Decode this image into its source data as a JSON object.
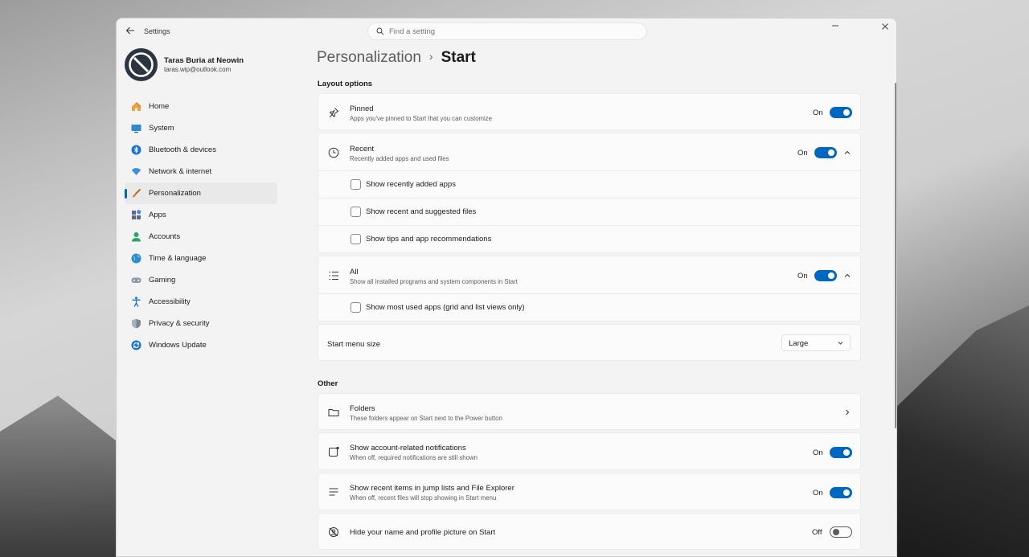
{
  "window": {
    "app_title": "Settings"
  },
  "search": {
    "placeholder": "Find a setting"
  },
  "user": {
    "name": "Taras Buria at Neowin",
    "email": "taras.wip@outlook.com"
  },
  "sidebar": {
    "items": [
      {
        "label": "Home",
        "icon": "home-icon"
      },
      {
        "label": "System",
        "icon": "monitor-icon"
      },
      {
        "label": "Bluetooth & devices",
        "icon": "bluetooth-icon"
      },
      {
        "label": "Network & internet",
        "icon": "wifi-icon"
      },
      {
        "label": "Personalization",
        "icon": "brush-icon",
        "active": true
      },
      {
        "label": "Apps",
        "icon": "apps-icon"
      },
      {
        "label": "Accounts",
        "icon": "person-icon"
      },
      {
        "label": "Time & language",
        "icon": "globe-icon"
      },
      {
        "label": "Gaming",
        "icon": "gamepad-icon"
      },
      {
        "label": "Accessibility",
        "icon": "accessibility-icon"
      },
      {
        "label": "Privacy & security",
        "icon": "shield-icon"
      },
      {
        "label": "Windows Update",
        "icon": "update-icon"
      }
    ]
  },
  "breadcrumb": {
    "parent": "Personalization",
    "separator": "›",
    "current": "Start"
  },
  "layout_options": {
    "heading": "Layout options",
    "pinned": {
      "title": "Pinned",
      "desc": "Apps you've pinned to Start that you can customize",
      "state": "On"
    },
    "recent": {
      "title": "Recent",
      "desc": "Recently added apps and used files",
      "state": "On",
      "options": [
        "Show recently added apps",
        "Show recent and suggested files",
        "Show tips and app recommendations"
      ]
    },
    "all": {
      "title": "All",
      "desc": "Show all installed programs and system components in Start",
      "state": "On",
      "options": [
        "Show most used apps (grid and list views only)"
      ]
    },
    "size": {
      "title": "Start menu size",
      "value": "Large"
    }
  },
  "other": {
    "heading": "Other",
    "folders": {
      "title": "Folders",
      "desc": "These folders appear on Start next to the Power button"
    },
    "account_notifications": {
      "title": "Show account-related notifications",
      "desc": "When off, required notifications are still shown",
      "state": "On"
    },
    "recent_items": {
      "title": "Show recent items in jump lists and File Explorer",
      "desc": "When off, recent files will stop showing in Start menu",
      "state": "On"
    },
    "hide_profile": {
      "title": "Hide your name and profile picture on Start",
      "state": "Off"
    }
  },
  "colors": {
    "accent": "#0067c0",
    "window_bg": "#f3f3f3",
    "card_bg": "#fbfbfb"
  }
}
